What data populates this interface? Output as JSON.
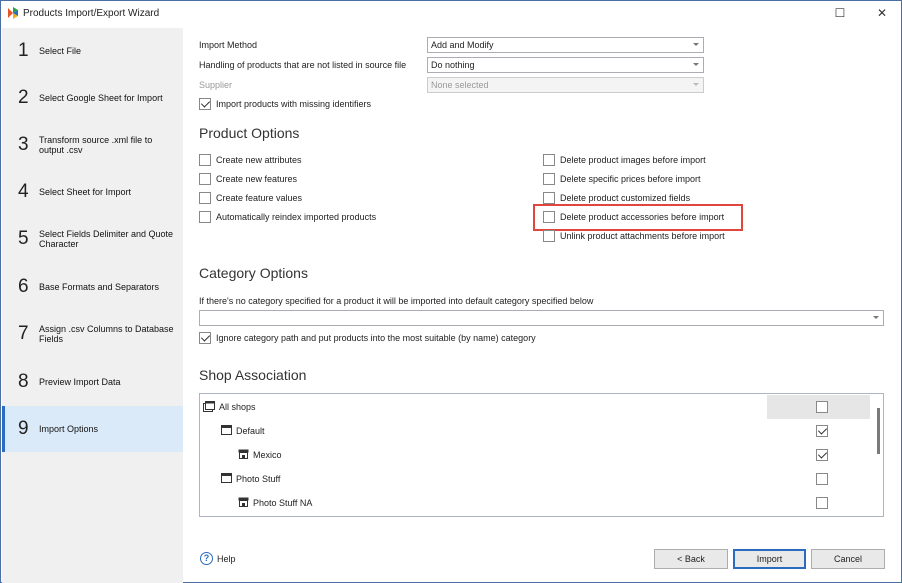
{
  "window": {
    "title": "Products Import/Export Wizard"
  },
  "steps": [
    {
      "num": "1",
      "label": "Select File"
    },
    {
      "num": "2",
      "label": "Select Google Sheet for Import"
    },
    {
      "num": "3",
      "label": "Transform source .xml file to output .csv"
    },
    {
      "num": "4",
      "label": "Select Sheet for Import"
    },
    {
      "num": "5",
      "label": "Select Fields Delimiter and Quote Character"
    },
    {
      "num": "6",
      "label": "Base Formats and Separators"
    },
    {
      "num": "7",
      "label": "Assign .csv Columns to Database Fields"
    },
    {
      "num": "8",
      "label": "Preview Import Data"
    },
    {
      "num": "9",
      "label": "Import Options"
    }
  ],
  "import_method": {
    "label": "Import Method",
    "value": "Add and Modify"
  },
  "handling": {
    "label": "Handling of products that are not listed in source file",
    "value": "Do nothing"
  },
  "supplier": {
    "label": "Supplier",
    "value": "None selected"
  },
  "missing_identifiers": {
    "label": "Import products with missing identifiers",
    "checked": true
  },
  "product_options": {
    "title": "Product Options",
    "left": [
      {
        "label": "Create new attributes",
        "checked": false
      },
      {
        "label": "Create new features",
        "checked": false
      },
      {
        "label": "Create feature values",
        "checked": false
      },
      {
        "label": "Automatically reindex imported products",
        "checked": false
      }
    ],
    "right": [
      {
        "label": "Delete product images before import",
        "checked": false
      },
      {
        "label": "Delete specific prices before import",
        "checked": false
      },
      {
        "label": "Delete product customized fields",
        "checked": false
      },
      {
        "label": "Delete product accessories before import",
        "checked": false
      },
      {
        "label": "Unlink product attachments before import",
        "checked": false
      }
    ]
  },
  "category_options": {
    "title": "Category Options",
    "hint": "If there's no category specified for a product it will be imported into default category specified below",
    "default_category": "",
    "ignore_path": {
      "label": "Ignore category path and put products into the most suitable (by name) category",
      "checked": true
    }
  },
  "shop_association": {
    "title": "Shop Association",
    "rows": [
      {
        "name": "All shops",
        "checked": false
      },
      {
        "name": "Default",
        "checked": true
      },
      {
        "name": "Mexico",
        "checked": true
      },
      {
        "name": "Photo Stuff",
        "checked": false
      },
      {
        "name": "Photo Stuff NA",
        "checked": false
      }
    ]
  },
  "footer": {
    "help": "Help",
    "back": "< Back",
    "import": "Import",
    "cancel": "Cancel"
  },
  "colors": {
    "accent": "#2a6cbf",
    "highlight": "#e2453c",
    "sidebar_bg": "#f0f0f0",
    "active_step_bg": "#dbeaf9"
  }
}
